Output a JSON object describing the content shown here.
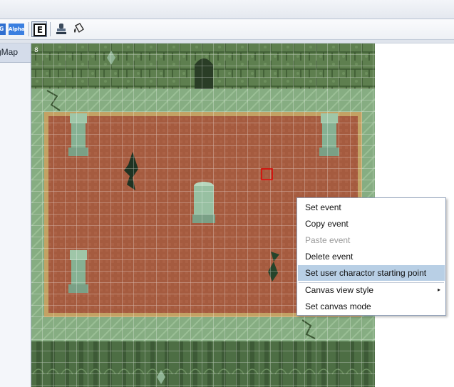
{
  "toolbar": {
    "buttons": [
      {
        "name": "png-export",
        "icon_text": "G"
      },
      {
        "name": "alpha",
        "icon_text": "Alpha"
      },
      {
        "name": "event-mode",
        "icon_text": "E"
      },
      {
        "name": "stamp",
        "icon": "stamp-icon"
      },
      {
        "name": "fill",
        "icon": "paint-bucket-icon"
      }
    ]
  },
  "sidebar": {
    "items": [
      {
        "label": "gMap"
      }
    ]
  },
  "map": {
    "layer_label": "8",
    "colors": {
      "wall_dark": "#4c6e40",
      "wall_mid": "#5d7f4f",
      "floor_green": "#7fa77b",
      "carpet": "#a65a3e",
      "carpet_border": "#c2a05a",
      "selection": "#dd0000",
      "grid": "#ffffff"
    }
  },
  "context_menu": {
    "items": [
      {
        "label": "Set event",
        "enabled": true
      },
      {
        "label": "Copy event",
        "enabled": true
      },
      {
        "label": "Paste event",
        "enabled": false
      },
      {
        "label": "Delete event",
        "enabled": true
      },
      {
        "label": "Set user charactor starting point",
        "enabled": true,
        "highlighted": true
      },
      {
        "label": "Canvas view style",
        "enabled": true,
        "submenu": true
      },
      {
        "label": "Set canvas mode",
        "enabled": true
      }
    ],
    "submenu_arrow": "▸"
  }
}
